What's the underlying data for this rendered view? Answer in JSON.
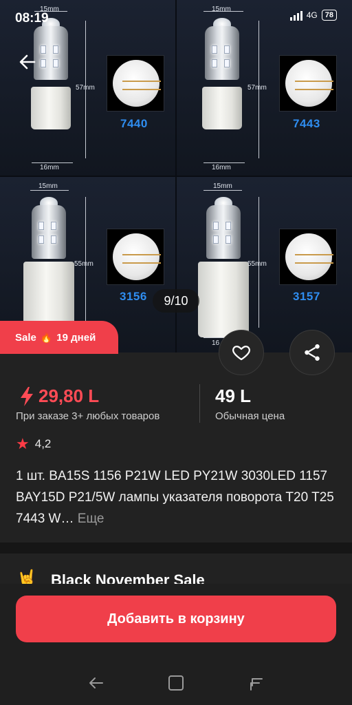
{
  "status_bar": {
    "time": "08:19",
    "network": "4G",
    "battery": "78"
  },
  "gallery": {
    "counter": "9/10",
    "quadrants": [
      {
        "model": "7440",
        "width_label": "15mm",
        "height_label": "57mm",
        "base_label": "16mm"
      },
      {
        "model": "7443",
        "width_label": "15mm",
        "height_label": "57mm",
        "base_label": "16mm"
      },
      {
        "model": "3156",
        "width_label": "15mm",
        "height_label": "55mm",
        "base_label": ""
      },
      {
        "model": "3157",
        "width_label": "15mm",
        "height_label": "55mm",
        "base_label": "16"
      }
    ]
  },
  "sale": {
    "label": "Sale",
    "days": "19 дней"
  },
  "pricing": {
    "promo_price": "29,80 L",
    "promo_note": "При заказе 3+ любых товаров",
    "regular_price": "49 L",
    "regular_note": "Обычная цена"
  },
  "rating": {
    "value": "4,2"
  },
  "product": {
    "title": "1 шт. BA15S 1156 P21W LED PY21W 3030LED 1157 BAY15D P21/5W лампы указателя поворота T20 T25 7443 W…",
    "more_label": "Еще"
  },
  "promo_banner": {
    "text": "Black November Sale"
  },
  "actions": {
    "add_to_cart": "Добавить в корзину"
  },
  "icons": {
    "back": "arrow-left-icon",
    "like": "heart-icon",
    "share": "share-icon",
    "promo": "hand-horns-icon"
  },
  "colors": {
    "accent": "#f03f4a",
    "price": "#ff4b55",
    "model_label": "#2f8df0"
  }
}
